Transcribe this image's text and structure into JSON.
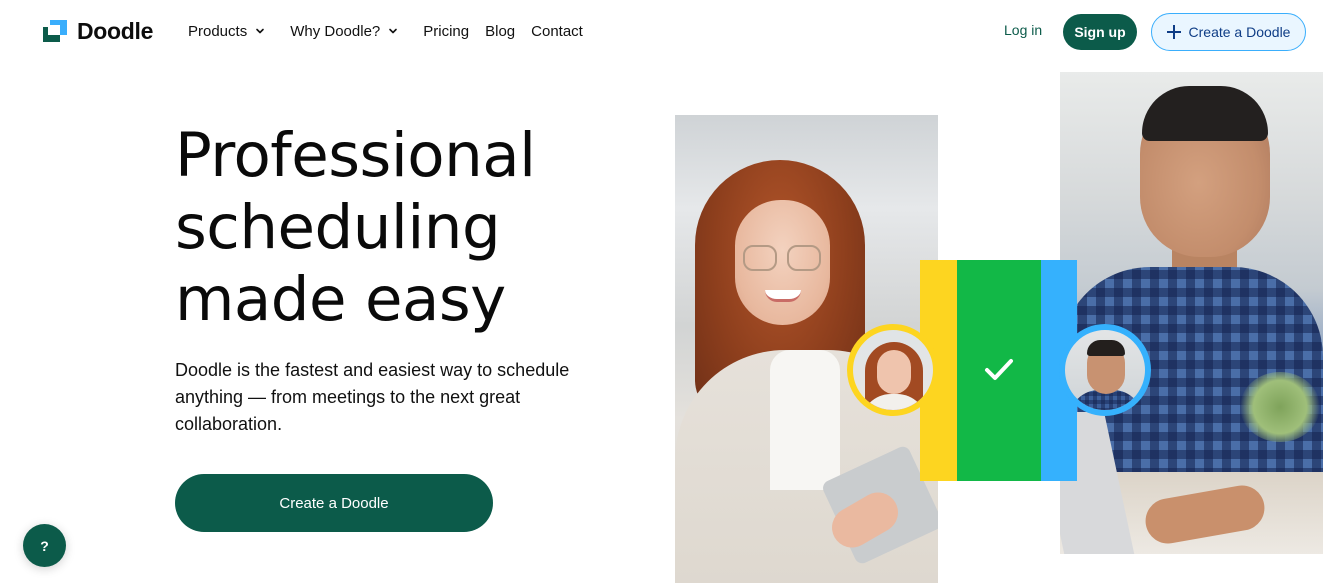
{
  "header": {
    "logo_text": "Doodle",
    "nav": [
      {
        "label": "Products",
        "has_dropdown": true
      },
      {
        "label": "Why Doodle?",
        "has_dropdown": true
      },
      {
        "label": "Pricing",
        "has_dropdown": false
      },
      {
        "label": "Blog",
        "has_dropdown": false
      },
      {
        "label": "Contact",
        "has_dropdown": false
      }
    ],
    "login_label": "Log in",
    "signup_label": "Sign up",
    "create_label": "Create a Doodle",
    "create_icon": "plus-icon"
  },
  "hero": {
    "headline_lines": [
      "Professional",
      "scheduling",
      "made easy"
    ],
    "subtext": "Doodle is the fastest and easiest way to schedule anything — from meetings to the next great collaboration.",
    "cta_label": "Create a Doodle"
  },
  "help": {
    "label": "?",
    "icon": "help-icon"
  },
  "imagery": {
    "left_photo": "woman-with-tablet-photo",
    "right_photo": "man-at-laptop-photo",
    "check_icon": "checkmark-icon",
    "colors": {
      "brand_green": "#0c5b4a",
      "logo_blue": "#3aaefc",
      "bar_yellow": "#fdd520",
      "bar_green": "#12b847",
      "bar_blue": "#35b1fd",
      "outline_button_bg": "#eaf6ff",
      "outline_button_text": "#0f3d86"
    }
  }
}
